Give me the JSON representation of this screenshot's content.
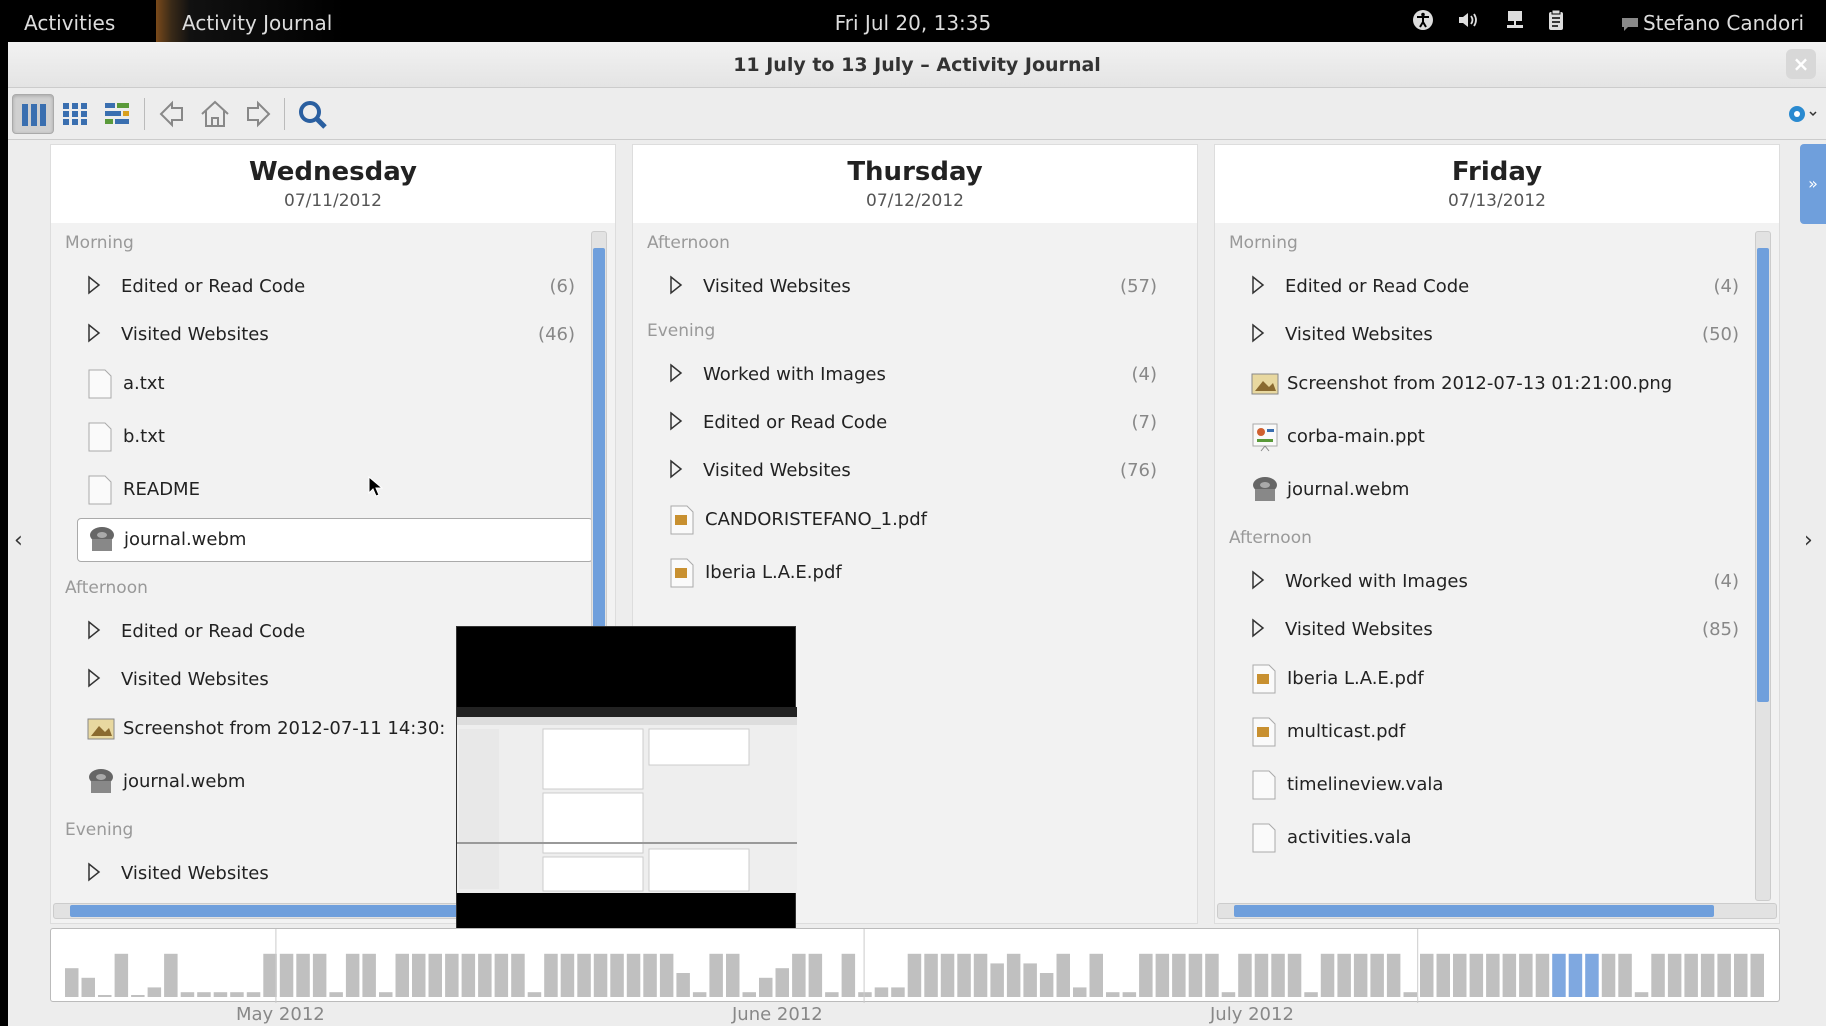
{
  "topbar": {
    "activities": "Activities",
    "app_name": "Activity Journal",
    "clock": "Fri Jul 20, 13:35",
    "user": "Stefano Candori",
    "icons": [
      "accessibility-icon",
      "volume-icon",
      "network-icon",
      "clipboard-icon"
    ]
  },
  "window": {
    "title": "11 July to 13 July – Activity Journal",
    "close": "×"
  },
  "days": [
    {
      "name": "Wednesday",
      "date": "07/11/2012",
      "sections": [
        {
          "label": "Morning",
          "groups": [
            {
              "label": "Edited or Read Code",
              "count": "(6)"
            },
            {
              "label": "Visited Websites",
              "count": "(46)"
            }
          ],
          "files": [
            {
              "name": "a.txt",
              "icon": "text-file-icon"
            },
            {
              "name": "b.txt",
              "icon": "text-file-icon"
            },
            {
              "name": "README",
              "icon": "text-file-icon"
            },
            {
              "name": "journal.webm",
              "icon": "video-file-icon",
              "selected": true
            }
          ]
        },
        {
          "label": "Afternoon",
          "groups": [
            {
              "label": "Edited or Read Code",
              "count": ""
            },
            {
              "label": "Visited Websites",
              "count": ""
            }
          ],
          "files": [
            {
              "name": "Screenshot from 2012-07-11 14:30:",
              "icon": "image-file-icon"
            },
            {
              "name": "journal.webm",
              "icon": "video-file-icon"
            }
          ]
        },
        {
          "label": "Evening",
          "groups": [
            {
              "label": "Visited Websites",
              "count": ""
            }
          ],
          "files": []
        }
      ]
    },
    {
      "name": "Thursday",
      "date": "07/12/2012",
      "sections": [
        {
          "label": "Afternoon",
          "groups": [
            {
              "label": "Visited Websites",
              "count": "(57)"
            }
          ],
          "files": []
        },
        {
          "label": "Evening",
          "groups": [
            {
              "label": "Worked with Images",
              "count": "(4)"
            },
            {
              "label": "Edited or Read Code",
              "count": "(7)"
            },
            {
              "label": "Visited Websites",
              "count": "(76)"
            }
          ],
          "files": [
            {
              "name": "CANDORISTEFANO_1.pdf",
              "icon": "pdf-file-icon"
            },
            {
              "name": "Iberia L.A.E.pdf",
              "icon": "pdf-file-icon"
            }
          ]
        }
      ]
    },
    {
      "name": "Friday",
      "date": "07/13/2012",
      "sections": [
        {
          "label": "Morning",
          "groups": [
            {
              "label": "Edited or Read Code",
              "count": "(4)"
            },
            {
              "label": "Visited Websites",
              "count": "(50)"
            }
          ],
          "files": [
            {
              "name": "Screenshot from 2012-07-13 01:21:00.png",
              "icon": "image-file-icon"
            },
            {
              "name": "corba-main.ppt",
              "icon": "presentation-file-icon"
            },
            {
              "name": "journal.webm",
              "icon": "video-file-icon"
            }
          ]
        },
        {
          "label": "Afternoon",
          "groups": [
            {
              "label": "Worked with Images",
              "count": "(4)"
            },
            {
              "label": "Visited Websites",
              "count": "(85)"
            }
          ],
          "files": [
            {
              "name": "Iberia L.A.E.pdf",
              "icon": "pdf-file-icon"
            },
            {
              "name": "multicast.pdf",
              "icon": "pdf-file-icon"
            },
            {
              "name": "timelineview.vala",
              "icon": "text-file-icon"
            },
            {
              "name": "activities.vala",
              "icon": "text-file-icon"
            }
          ]
        }
      ]
    }
  ],
  "timeline": {
    "months": [
      "May 2012",
      "June 2012",
      "July 2012"
    ],
    "bars": [
      0.6,
      0.4,
      0,
      0.9,
      0,
      0.2,
      0.9,
      0.1,
      0.1,
      0.1,
      0.1,
      0.1,
      0.9,
      0.9,
      0.9,
      0.9,
      0.1,
      0.9,
      0.9,
      0.1,
      0.9,
      0.9,
      0.9,
      0.9,
      0.9,
      0.9,
      0.9,
      0.9,
      0.1,
      0.9,
      0.9,
      0.9,
      0.9,
      0.9,
      0.9,
      0.9,
      0.9,
      0.5,
      0.1,
      0.9,
      0.9,
      0.1,
      0.4,
      0.6,
      0.9,
      0.9,
      0.1,
      0.9,
      0.1,
      0.2,
      0.2,
      0.9,
      0.9,
      0.9,
      0.9,
      0.9,
      0.7,
      0.9,
      0.7,
      0.5,
      0.9,
      0.2,
      0.9,
      0.1,
      0.1,
      0.9,
      0.9,
      0.9,
      0.9,
      0.9,
      0.1,
      0.9,
      0.9,
      0.9,
      0.9,
      0.1,
      0.9,
      0.9,
      0.9,
      0.9,
      0.9,
      0.1,
      0.9,
      0.9,
      0.9,
      0.9,
      0.9,
      0.9,
      0.9,
      0.9,
      0.9,
      0.9,
      0.9,
      0.9,
      0.9,
      0.1,
      0.9,
      0.9,
      0.9,
      0.9,
      0.9,
      0.9,
      0.9
    ],
    "highlight": [
      90,
      91,
      92
    ],
    "bar_color": "#c0c0c0",
    "highlight_color": "#7fa8e0"
  },
  "accent": "#6f9fdc"
}
